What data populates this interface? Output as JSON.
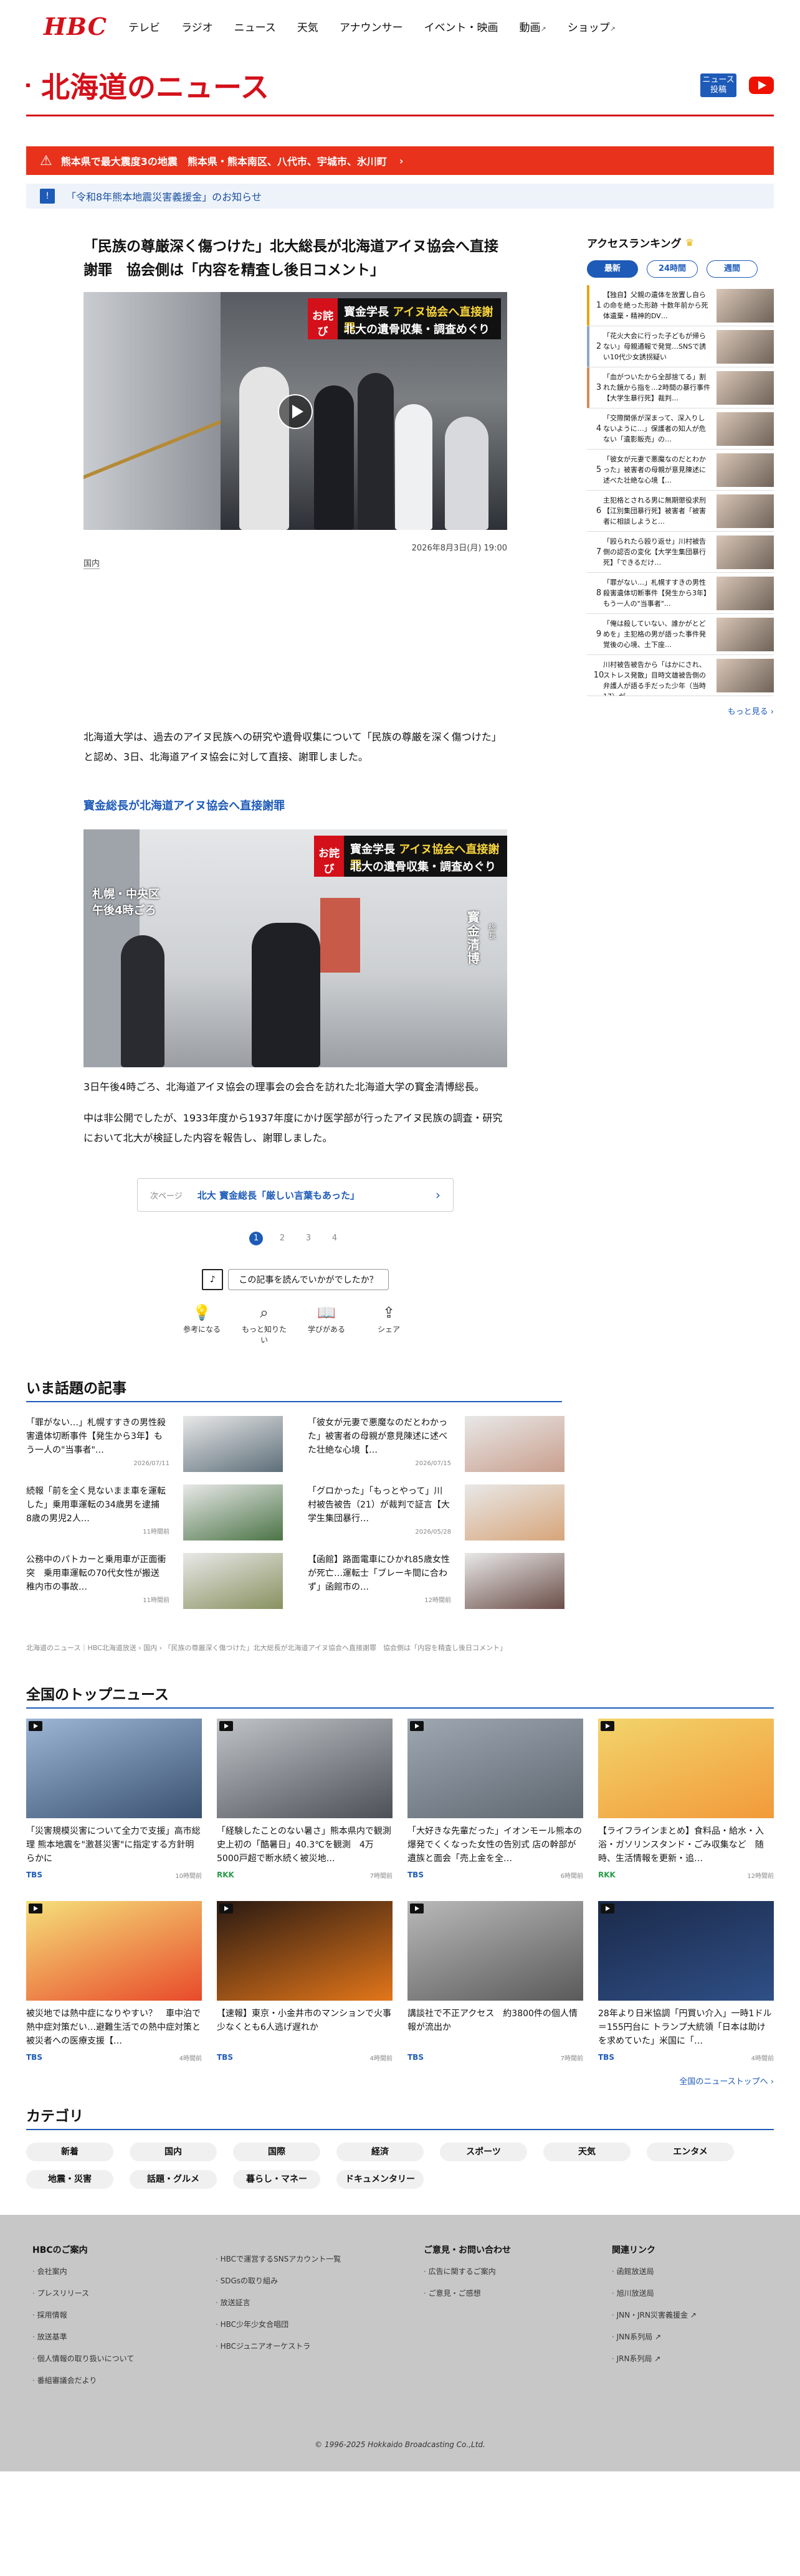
{
  "brand": {
    "logo": "HBC",
    "accent": "#d4101a",
    "link": "#1e5bb8"
  },
  "gnav": [
    {
      "label": "テレビ"
    },
    {
      "label": "ラジオ"
    },
    {
      "label": "ニュース"
    },
    {
      "label": "天気"
    },
    {
      "label": "アナウンサー"
    },
    {
      "label": "イベント・映画"
    },
    {
      "label": "動画",
      "ext": "↗"
    },
    {
      "label": "ショップ",
      "ext": "↗"
    }
  ],
  "page": {
    "title": "北海道のニュース",
    "news_badge": "ニュース\n投稿"
  },
  "alert": {
    "text": "熊本県で最大震度3の地震　熊本県・熊本南区、八代市、宇城市、氷川町",
    "chev": "›"
  },
  "notice": {
    "text": "「令和8年熊本地震災害義援金」のお知らせ",
    "chev": "›"
  },
  "article": {
    "title": "「民族の尊厳深く傷つけた」北大総長が北海道アイヌ協会へ直接謝罪　協会側は「内容を精査し後日コメント」",
    "video_telop_tag": "お詫び",
    "video_telop_l1a": "寳金学長 ",
    "video_telop_l1b": "アイヌ協会へ直接謝罪",
    "video_telop_l2": "北大の遺骨収集・調査めぐり",
    "date": "2026年8月3日(月) 19:00",
    "category": "国内",
    "p1": "北海道大学は、過去のアイヌ民族への研究や遺骨収集について「民族の尊厳を深く傷つけた」と認め、3日、北海道アイヌ協会に対して直接、謝罪しました。",
    "subhead": "寳金総長が北海道アイヌ協会へ直接謝罪",
    "photo_loc": "札幌・中央区\n午後4時ごろ",
    "photo_name": "寳金\n清博",
    "photo_role": "総長",
    "p2": "3日午後4時ごろ、北海道アイヌ協会の理事会の会合を訪れた北海道大学の寳金清博総長。",
    "p3": "中は非公開でしたが、1933年度から1937年度にかけ医学部が行ったアイヌ民族の調査・研究において北大が検証した内容を報告し、謝罪しました。",
    "next_label": "次ページ",
    "next_title": "北大 寳金総長「厳しい言葉もあった」",
    "pages": [
      "1",
      "2",
      "3",
      "4"
    ],
    "feedback_q": "この記事を読んでいかがでしたか？",
    "reactions": [
      {
        "icon": "💡",
        "label": "参考になる"
      },
      {
        "icon": "⌕",
        "label": "もっと知りたい"
      },
      {
        "icon": "📖",
        "label": "学びがある"
      },
      {
        "icon": "⇪",
        "label": "シェア"
      }
    ]
  },
  "ranking": {
    "title": "アクセスランキング",
    "tabs": [
      "最新",
      "24時間",
      "週間"
    ],
    "items": [
      {
        "num": "1",
        "color": "#e8a317",
        "text": "【独自】父親の遺体を放置し自らの命を絶った形跡 十数年前から死体遺棄・精神的DV…"
      },
      {
        "num": "2",
        "color": "#8fa6c8",
        "text": "「花火大会に行った子どもが帰らない」母親通報で発覚…SNSで誘い10代少女誘拐疑い"
      },
      {
        "num": "3",
        "color": "#d78a55",
        "text": "「血がついたから全部捨てる」割れた鏡から指を…2時間の暴行事件【大学生暴行死】裁判…"
      },
      {
        "num": "4",
        "color": "#fff",
        "text": "「交際関係が深まって、深入りしないように…」保護者の知人が危ない「遺影販売」の…"
      },
      {
        "num": "5",
        "color": "#fff",
        "text": "「彼女が元妻で悪魔なのだとわかった」被害者の母親が意見陳述に述べた壮絶な心境【…"
      },
      {
        "num": "6",
        "color": "#fff",
        "text": "主犯格とされる男に無期懲役求刑【江別集団暴行死】被害者「被害者に相談しようと…"
      },
      {
        "num": "7",
        "color": "#fff",
        "text": "「殴られたら殴り返せ」川村被告側の認否の変化【大学生集団暴行死】「できるだけ…"
      },
      {
        "num": "8",
        "color": "#fff",
        "text": "「罪がない…」札幌すすきの男性殺害遺体切断事件【発生から3年】もう一人の\"当事者\"…"
      },
      {
        "num": "9",
        "color": "#fff",
        "text": "「俺は殺していない、誰かがとどめを」主犯格の男が語った事件発覚後の心境、土下座…"
      },
      {
        "num": "10",
        "color": "#fff",
        "text": "川村被告被告から「はかにされ、ストレス発散」目時文雄被告側の弁護人が語る手だった少年（当時17）が…"
      }
    ],
    "more": "もっと見る ›"
  },
  "trending": {
    "title": "いま話題の記事",
    "items": [
      {
        "text": "「罪がない…」札幌すすきの男性殺害遺体切断事件【発生から3年】もう一人の\"当事者\"…",
        "time": "2026/07/11",
        "c": "#5d6e79"
      },
      {
        "text": "「彼女が元妻で悪魔なのだとわかった」被害者の母親が意見陳述に述べた壮絶な心境【…",
        "time": "2026/07/15",
        "c": "#c99f8d"
      },
      {
        "text": "続報「前を全く見ないまま車を運転した」乗用車運転の34歳男を逮捕　8歳の男児2人…",
        "time": "11時間前",
        "c": "#4b7446"
      },
      {
        "text": "「グロかった」「もっとやって」川村被告被告（21）が裁判で証言【大学生集団暴行…",
        "time": "2026/05/28",
        "c": "#d7a57a"
      },
      {
        "text": "公務中のパトカーと乗用車が正面衝突　乗用車運転の70代女性が搬送　稚内市の事故…",
        "time": "11時間前",
        "c": "#88915f"
      },
      {
        "text": "【函館】路面電車にひかれ85歳女性が死亡…運転士「ブレーキ間に合わず」函館市の…",
        "time": "12時間前",
        "c": "#6b4e48"
      }
    ]
  },
  "breadcrumb": "北海道のニュース｜HBC北海道放送 › 国内 › 「民族の尊厳深く傷つけた」北大総長が北海道アイヌ協会へ直接謝罪　協会側は「内容を精査し後日コメント」",
  "topnews": {
    "title": "全国のトップニュース",
    "items": [
      {
        "text": "「災害規模災害について全力で支援」高市総理 熊本地震を\"激甚災害\"に指定する方針明らかに",
        "src": "TBS",
        "srcc": "#1e5bb8",
        "ago": "10時間前",
        "c1": "#9db6d6",
        "c2": "#3a5170"
      },
      {
        "text": "「経験したことのない暑さ」熊本県内で観測史上初の「酷暑日」40.3℃を観測　4万5000戸超で断水続く被災地…",
        "src": "RKK",
        "srcc": "#2a9b4b",
        "ago": "7時間前",
        "c1": "#c0c3c8",
        "c2": "#4d5157"
      },
      {
        "text": "「大好きな先輩だった」イオンモール熊本の爆発でくくなった女性の告別式 店の幹部が遺族と面会「売上金を全…",
        "src": "TBS",
        "srcc": "#1e5bb8",
        "ago": "6時間前",
        "c1": "#9fa8b2",
        "c2": "#5e6670"
      },
      {
        "text": "【ライフラインまとめ】食料品・給水・入浴・ガソリンスタンド・ごみ収集など　随時、生活情報を更新・追…",
        "src": "RKK",
        "srcc": "#2a9b4b",
        "ago": "12時間前",
        "c1": "#f2d46b",
        "c2": "#f29a3a"
      },
      {
        "text": "被災地では熱中症になりやすい？　車中泊で熱中症対策だい…避難生活での熱中症対策と被災者への医療支援【…",
        "src": "TBS",
        "srcc": "#1e5bb8",
        "ago": "4時間前",
        "c1": "#f5e07a",
        "c2": "#e84a2a"
      },
      {
        "text": "【速報】東京・小金井市のマンションで火事　少なくとも6人逃げ遅れか",
        "src": "TBS",
        "srcc": "#1e5bb8",
        "ago": "4時間前",
        "c1": "#2a1a12",
        "c2": "#e2761a"
      },
      {
        "text": "講談社で不正アクセス　約3800件の個人情報が流出か",
        "src": "TBS",
        "srcc": "#1e5bb8",
        "ago": "7時間前",
        "c1": "#b9b9b9",
        "c2": "#5a5a5a"
      },
      {
        "text": "28年より日米協調「円買い介入」一時1ドル＝155円台に トランプ大統領「日本は助けを求めていた」米国に「…",
        "src": "TBS",
        "srcc": "#1e5bb8",
        "ago": "4時間前",
        "c1": "#1b2a4a",
        "c2": "#2f4f86"
      }
    ],
    "more": "全国のニューストップへ ›"
  },
  "categories": {
    "title": "カテゴリ",
    "items": [
      "新着",
      "国内",
      "国際",
      "経済",
      "スポーツ",
      "天気",
      "エンタメ",
      "地震・災害",
      "話題・グルメ",
      "暮らし・マネー",
      "ドキュメンタリー"
    ]
  },
  "footer": {
    "cols": [
      {
        "title": "HBCのご案内",
        "items": [
          "会社案内",
          "プレスリリース",
          "採用情報",
          "放送基準",
          "個人情報の取り扱いについて",
          "番組審議会だより"
        ]
      },
      {
        "title": "",
        "items": [
          "HBCで運営するSNSアカウント一覧",
          "SDGsの取り組み",
          "放送証言",
          "HBC少年少女合唱団",
          "HBCジュニアオーケストラ"
        ]
      },
      {
        "title": "ご意見・お問い合わせ",
        "items": [
          "広告に関するご案内",
          "ご意見・ご感想"
        ]
      },
      {
        "title": "関連リンク",
        "items": [
          "函館放送局",
          "旭川放送局",
          "JNN・JRN災害義援金 ↗",
          "JNN系列局 ↗",
          "JRN系列局 ↗"
        ]
      }
    ],
    "copyright": "© 1996-2025 Hokkaido Broadcasting Co.,Ltd."
  }
}
